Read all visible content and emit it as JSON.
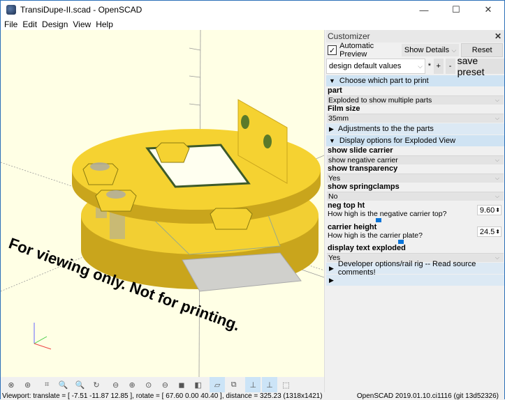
{
  "window": {
    "title": "TransiDupe-II.scad - OpenSCAD",
    "controls": {
      "minimize": "—",
      "maximize": "☐",
      "close": "✕"
    }
  },
  "menu": [
    "File",
    "Edit",
    "Design",
    "View",
    "Help"
  ],
  "viewport": {
    "overlay_text": "For viewing only.  Not for printing.",
    "background_color": "#ffffe5",
    "model_color": "#f5d231"
  },
  "toolbar": {
    "buttons": [
      {
        "icon": "preview-icon",
        "active": false
      },
      {
        "icon": "render-icon",
        "active": false
      },
      {
        "icon": "view-all-icon",
        "active": false
      },
      {
        "icon": "zoom-in-icon",
        "active": false
      },
      {
        "icon": "zoom-out-icon",
        "active": false
      },
      {
        "icon": "reset-view-icon",
        "active": false
      },
      {
        "icon": "view-right-icon",
        "active": false
      },
      {
        "icon": "view-top-icon",
        "active": false
      },
      {
        "icon": "view-bottom-icon",
        "active": false
      },
      {
        "icon": "view-left-icon",
        "active": false
      },
      {
        "icon": "view-front-icon",
        "active": false
      },
      {
        "icon": "view-back-icon",
        "active": false
      },
      {
        "icon": "perspective-icon",
        "active": true
      },
      {
        "icon": "orthogonal-icon",
        "active": false
      },
      {
        "icon": "show-axes-icon",
        "active": true
      },
      {
        "icon": "show-scale-markers-icon",
        "active": true
      },
      {
        "icon": "show-edges-icon",
        "active": false
      }
    ],
    "glyphs": [
      "⊗",
      "⊛",
      "⌗",
      "🔍",
      "🔍",
      "↻",
      "⊖",
      "⊕",
      "⊙",
      "⊖",
      "◼",
      "◧",
      "▱",
      "⧉",
      "⊥",
      "⊥",
      "⬚"
    ]
  },
  "status": {
    "left": "Viewport: translate = [ -7.51 -11.87 12.85 ], rotate = [ 67.60 0.00 40.40 ], distance = 325.23 (1318x1421)",
    "right": "OpenSCAD 2019.01.10.ci1116 (git 13d52326)"
  },
  "customizer": {
    "title": "Customizer",
    "close": "✕",
    "automatic_preview_label": "Automatic Preview",
    "automatic_preview_checked": true,
    "details_mode": "Show Details",
    "reset_label": "Reset",
    "preset": "design default values",
    "preset_modified": "*",
    "add_preset": "+",
    "remove_preset": "-",
    "save_preset": "save preset",
    "groups": [
      {
        "label": "Choose which part to print",
        "expanded": true
      },
      {
        "label": "Adjustments to the the parts",
        "expanded": false
      },
      {
        "label": "Display options for Exploded View",
        "expanded": true
      },
      {
        "label": "Developer options/rail rig -- Read source comments!",
        "expanded": false
      },
      {
        "label": "",
        "expanded": false
      }
    ],
    "params": {
      "part": {
        "name": "part",
        "value": "Exploded to show multiple parts"
      },
      "film_size": {
        "name": "Film size",
        "value": "35mm"
      },
      "show_slide_carrier": {
        "name": "show slide carrier",
        "value": "show negative carrier"
      },
      "show_transparency": {
        "name": "show transparency",
        "value": "Yes"
      },
      "show_springclamps": {
        "name": "show springclamps",
        "value": "No"
      },
      "neg_top_ht": {
        "name": "neg top ht",
        "description": "How high is the negative carrier top?",
        "value": "9.60",
        "slider_fraction": 0.3
      },
      "carrier_height": {
        "name": "carrier height",
        "description": "How high is the carrier plate?",
        "value": "24.5",
        "slider_fraction": 0.44
      },
      "display_text_exploded": {
        "name": "display text exploded",
        "value": "Yes"
      }
    }
  }
}
